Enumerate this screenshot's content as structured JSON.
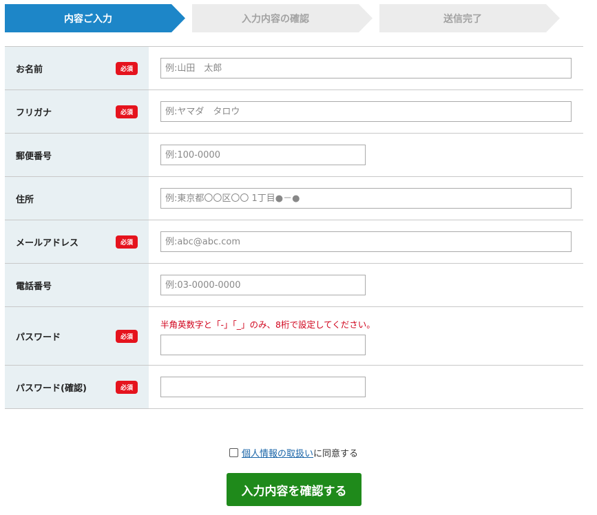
{
  "steps": [
    {
      "label": "内容ご入力",
      "state": "active"
    },
    {
      "label": "入力内容の確認",
      "state": "inactive"
    },
    {
      "label": "送信完了",
      "state": "inactive"
    }
  ],
  "required_badge": "必須",
  "fields": {
    "name": {
      "label": "お名前",
      "placeholder": "例:山田　太郎",
      "required": true
    },
    "furigana": {
      "label": "フリガナ",
      "placeholder": "例:ヤマダ　タロウ",
      "required": true
    },
    "postal": {
      "label": "郵便番号",
      "placeholder": "例:100-0000",
      "required": false
    },
    "address": {
      "label": "住所",
      "placeholder": "例:東京都〇〇区〇〇 1丁目●－●",
      "required": false
    },
    "email": {
      "label": "メールアドレス",
      "placeholder": "例:abc@abc.com",
      "required": true
    },
    "phone": {
      "label": "電話番号",
      "placeholder": "例:03-0000-0000",
      "required": false
    },
    "password": {
      "label": "パスワード",
      "note": "半角英数字と「-」「_」のみ、8桁で設定してください。",
      "placeholder": "",
      "required": true
    },
    "password_confirm": {
      "label": "パスワード(確認)",
      "placeholder": "",
      "required": true
    }
  },
  "agree": {
    "link_text": "個人情報の取扱い",
    "suffix": "に同意する",
    "checked": false
  },
  "submit_label": "入力内容を確認する",
  "colors": {
    "step_active": "#1d86c8",
    "step_inactive": "#ececec",
    "required": "#e5131d",
    "submit": "#1f8a1b",
    "note": "#d0021b"
  }
}
